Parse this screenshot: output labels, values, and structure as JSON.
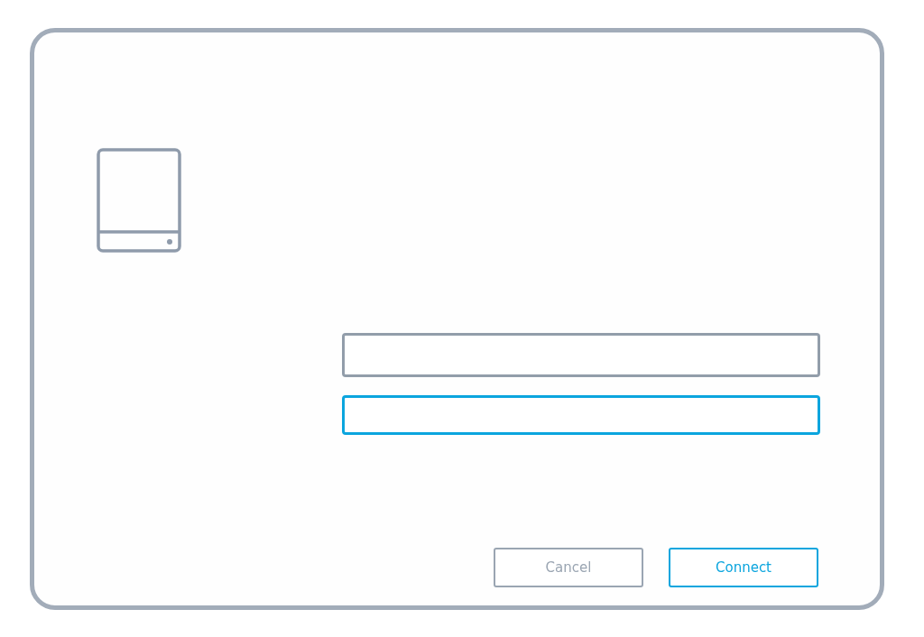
{
  "fields": [
    {
      "focused": false
    },
    {
      "focused": true
    }
  ],
  "buttons": [
    {
      "label": "Cancel",
      "primary": false
    },
    {
      "label": "Connect",
      "primary": true
    }
  ]
}
